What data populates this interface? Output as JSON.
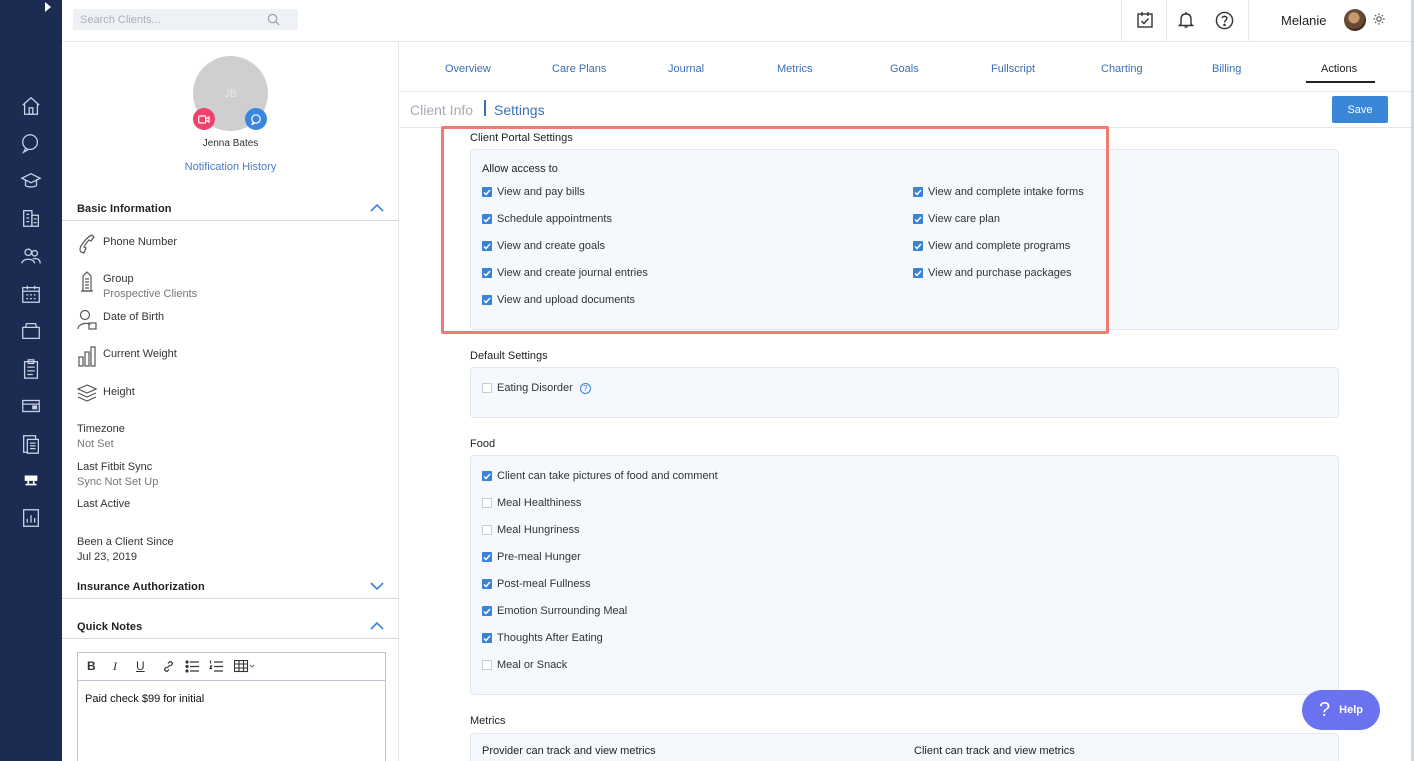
{
  "header": {
    "search_placeholder": "Search Clients...",
    "user_name": "Melanie"
  },
  "client": {
    "initials": "JB",
    "name": "Jenna Bates",
    "notification_link": "Notification History",
    "basic_info_title": "Basic Information",
    "fields": [
      {
        "label": "Phone Number",
        "value": ""
      },
      {
        "label": "Group",
        "value": "Prospective Clients"
      },
      {
        "label": "Date of Birth",
        "value": ""
      },
      {
        "label": "Current Weight",
        "value": ""
      },
      {
        "label": "Height",
        "value": ""
      }
    ],
    "plain_fields": [
      {
        "label": "Timezone",
        "value": "Not Set"
      },
      {
        "label": "Last Fitbit Sync",
        "value": "Sync Not Set Up"
      },
      {
        "label": "Last Active",
        "value": ""
      },
      {
        "label": "Been a Client Since",
        "value": "Jul 23, 2019"
      }
    ],
    "insurance_title": "Insurance Authorization",
    "quick_notes_title": "Quick Notes",
    "note_text": "Paid check $99 for initial"
  },
  "tabs": [
    "Overview",
    "Care Plans",
    "Journal",
    "Metrics",
    "Goals",
    "Fullscript",
    "Charting",
    "Billing",
    "Actions"
  ],
  "active_tab": "Actions",
  "subnav": {
    "client_info": "Client Info",
    "settings": "Settings",
    "save": "Save"
  },
  "portal": {
    "title": "Client Portal Settings",
    "allow_label": "Allow access to",
    "left": [
      {
        "label": "View and pay bills",
        "checked": true
      },
      {
        "label": "Schedule appointments",
        "checked": true
      },
      {
        "label": "View and create goals",
        "checked": true
      },
      {
        "label": "View and create journal entries",
        "checked": true
      },
      {
        "label": "View and upload documents",
        "checked": true
      }
    ],
    "right": [
      {
        "label": "View and complete intake forms",
        "checked": true
      },
      {
        "label": "View care plan",
        "checked": true
      },
      {
        "label": "View and complete programs",
        "checked": true
      },
      {
        "label": "View and purchase packages",
        "checked": true
      }
    ]
  },
  "defaults": {
    "title": "Default Settings",
    "items": [
      {
        "label": "Eating Disorder",
        "checked": false
      }
    ]
  },
  "food": {
    "title": "Food",
    "items": [
      {
        "label": "Client can take pictures of food and comment",
        "checked": true
      },
      {
        "label": "Meal Healthiness",
        "checked": false
      },
      {
        "label": "Meal Hungriness",
        "checked": false
      },
      {
        "label": "Pre-meal Hunger",
        "checked": true
      },
      {
        "label": "Post-meal Fullness",
        "checked": true
      },
      {
        "label": "Emotion Surrounding Meal",
        "checked": true
      },
      {
        "label": "Thoughts After Eating",
        "checked": true
      },
      {
        "label": "Meal or Snack",
        "checked": false
      }
    ]
  },
  "metrics": {
    "title": "Metrics",
    "provider_label": "Provider can track and view metrics",
    "client_label": "Client can track and view metrics"
  },
  "help_label": "Help",
  "colors": {
    "nav": "#1b2b52",
    "accent": "#3a82d6",
    "highlight": "#ef7b72",
    "help": "#6b72f0"
  }
}
